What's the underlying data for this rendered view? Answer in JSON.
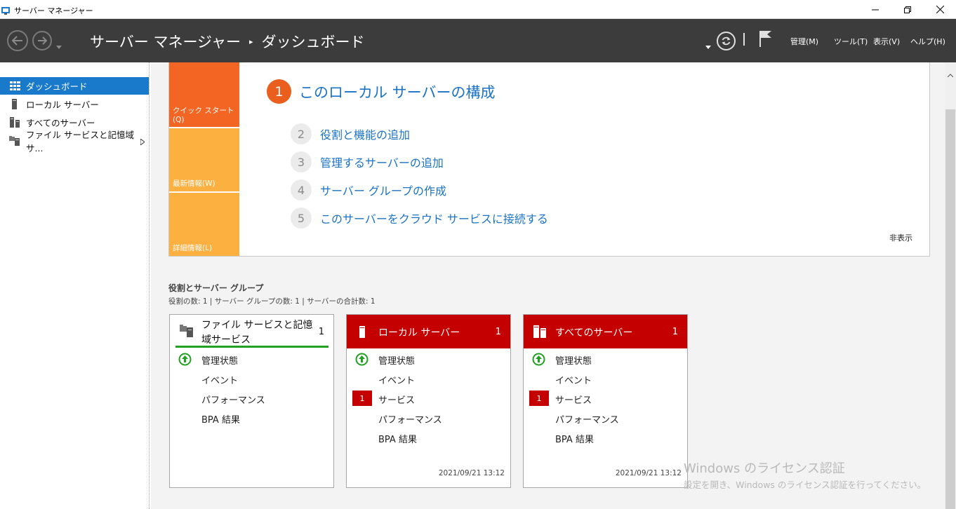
{
  "window": {
    "title": "サーバー マネージャー"
  },
  "header": {
    "app_name": "サーバー マネージャー",
    "separator": "▸",
    "page": "ダッシュボード",
    "menus": [
      "管理(M)",
      "ツール(T)",
      "表示(V)",
      "ヘルプ(H)"
    ]
  },
  "sidebar": {
    "items": [
      {
        "label": "ダッシュボード",
        "icon": "dashboard-icon",
        "active": true
      },
      {
        "label": "ローカル サーバー",
        "icon": "server-icon"
      },
      {
        "label": "すべてのサーバー",
        "icon": "servers-icon"
      },
      {
        "label": "ファイル サービスと記憶域サ...",
        "icon": "file-services-icon",
        "has_submenu": true
      }
    ]
  },
  "quickstart": {
    "tabs": [
      "クイック スタート(Q)",
      "最新情報(W)",
      "詳細情報(L)"
    ],
    "main_step": {
      "num": "1",
      "label": "このローカル サーバーの構成"
    },
    "steps": [
      {
        "num": "2",
        "label": "役割と機能の追加"
      },
      {
        "num": "3",
        "label": "管理するサーバーの追加"
      },
      {
        "num": "4",
        "label": "サーバー グループの作成"
      },
      {
        "num": "5",
        "label": "このサーバーをクラウド サービスに接続する"
      }
    ],
    "hide_label": "非表示"
  },
  "roles": {
    "title": "役割とサーバー グループ",
    "summary": "役割の数: 1   |   サーバー グループの数: 1   |   サーバーの合計数: 1",
    "tiles": [
      {
        "name": "ファイル サービスと記憶域サービス",
        "count": "1",
        "rows": {
          "manageability": "管理状態",
          "events": "イベント",
          "performance": "パフォーマンス",
          "bpa": "BPA 結果"
        }
      },
      {
        "name": "ローカル サーバー",
        "count": "1",
        "rows": {
          "manageability": "管理状態",
          "events": "イベント",
          "services": "サービス",
          "services_badge": "1",
          "performance": "パフォーマンス",
          "bpa": "BPA 結果"
        },
        "timestamp": "2021/09/21 13:12"
      },
      {
        "name": "すべてのサーバー",
        "count": "1",
        "rows": {
          "manageability": "管理状態",
          "events": "イベント",
          "services": "サービス",
          "services_badge": "1",
          "performance": "パフォーマンス",
          "bpa": "BPA 結果"
        },
        "timestamp": "2021/09/21 13:12"
      }
    ]
  },
  "watermark": {
    "line1": "Windows のライセンス認証",
    "line2": "設定を開き、Windows のライセンス認証を行ってください。"
  },
  "colors": {
    "header_bg": "#3c3c3c",
    "active_nav": "#1979ca",
    "quickstart_orange": "#f26522",
    "quickstart_yellow": "#fcb040",
    "link_blue": "#1a73c6",
    "alert_red": "#c40000",
    "ok_green": "#21a121"
  }
}
